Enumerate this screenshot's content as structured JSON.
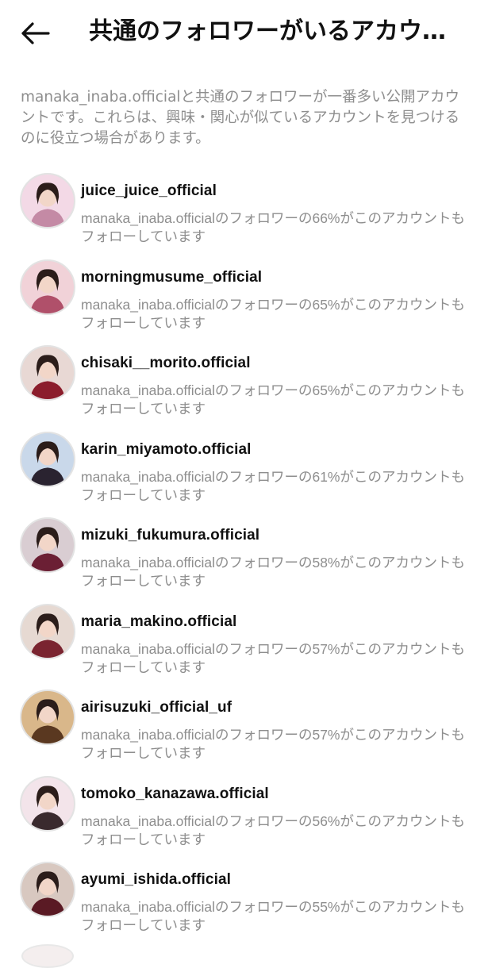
{
  "header": {
    "title": "共通のフォロワーがいるアカウ…",
    "back_icon": "arrow-left-icon"
  },
  "intro": "manaka_inaba.officialと共通のフォロワーが一番多い公開アカウントです。これらは、興味・関心が似ているアカウントを見つけるのに役立つ場合があります。",
  "accounts": [
    {
      "username": "juice_juice_official",
      "description": "manaka_inaba.officialのフォロワーの66%がこのアカウントもフォローしています",
      "avatar": {
        "bg": "#f3d9e6",
        "fg": "#c48aa5"
      }
    },
    {
      "username": "morningmusume_official",
      "description": "manaka_inaba.officialのフォロワーの65%がこのアカウントもフォローしています",
      "avatar": {
        "bg": "#f1d2d8",
        "fg": "#b0506a"
      }
    },
    {
      "username": "chisaki__morito.official",
      "description": "manaka_inaba.officialのフォロワーの65%がこのアカウントもフォローしています",
      "avatar": {
        "bg": "#e8d8d4",
        "fg": "#8b1d2c"
      }
    },
    {
      "username": "karin_miyamoto.official",
      "description": "manaka_inaba.officialのフォロワーの61%がこのアカウントもフォローしています",
      "avatar": {
        "bg": "#c9d8ea",
        "fg": "#2a2330"
      }
    },
    {
      "username": "mizuki_fukumura.official",
      "description": "manaka_inaba.officialのフォロワーの58%がこのアカウントもフォローしています",
      "avatar": {
        "bg": "#d9cdd2",
        "fg": "#6b1f34"
      }
    },
    {
      "username": "maria_makino.official",
      "description": "manaka_inaba.officialのフォロワーの57%がこのアカウントもフォローしています",
      "avatar": {
        "bg": "#e6d9d2",
        "fg": "#7a2430"
      }
    },
    {
      "username": "airisuzuki_official_uf",
      "description": "manaka_inaba.officialのフォロワーの57%がこのアカウントもフォローしています",
      "avatar": {
        "bg": "#d9b78a",
        "fg": "#5a3820"
      }
    },
    {
      "username": "tomoko_kanazawa.official",
      "description": "manaka_inaba.officialのフォロワーの56%がこのアカウントもフォローしています",
      "avatar": {
        "bg": "#f3e4ea",
        "fg": "#3a2a2e"
      }
    },
    {
      "username": "ayumi_ishida.official",
      "description": "manaka_inaba.officialのフォロワーの55%がこのアカウントもフォローしています",
      "avatar": {
        "bg": "#d8c8c0",
        "fg": "#5a1a24"
      }
    }
  ]
}
